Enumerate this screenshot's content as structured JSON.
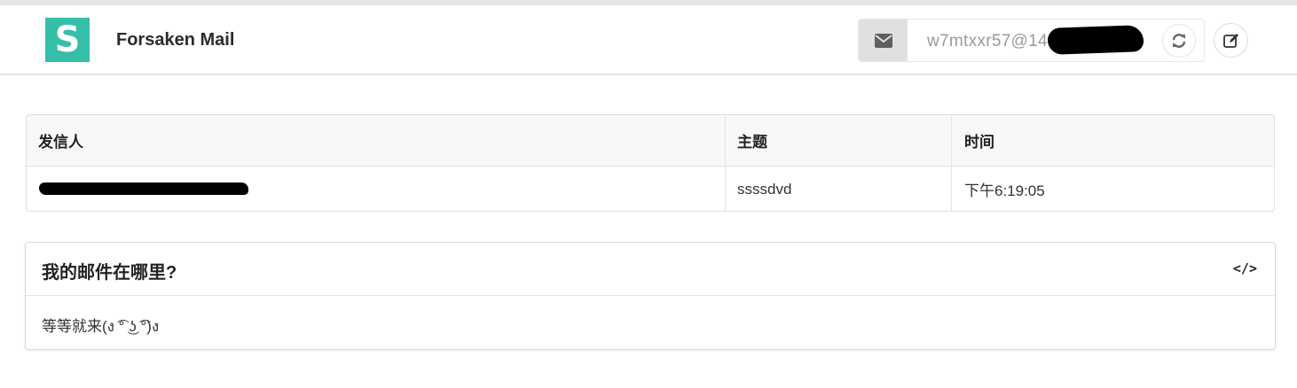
{
  "header": {
    "logo_letter": "S",
    "brand": "Forsaken Mail",
    "mail_address": "w7mtxxr57@14",
    "icons": {
      "mail": "envelope-icon",
      "refresh": "refresh-icon",
      "edit": "edit-icon"
    }
  },
  "inbox": {
    "columns": [
      "发信人",
      "主题",
      "时间"
    ],
    "rows": [
      {
        "sender": "",
        "subject": "ssssdvd",
        "time": "下午6:19:05"
      }
    ]
  },
  "faq": {
    "title": "我的邮件在哪里?",
    "code_icon_text": "</>",
    "body": "等等就来(ง ͡° ͜ʖ ͡°)ง"
  },
  "colors": {
    "logo_bg": "#35bfa8",
    "header_border": "#e3e3e3",
    "table_header_bg": "#f7f8f9"
  }
}
